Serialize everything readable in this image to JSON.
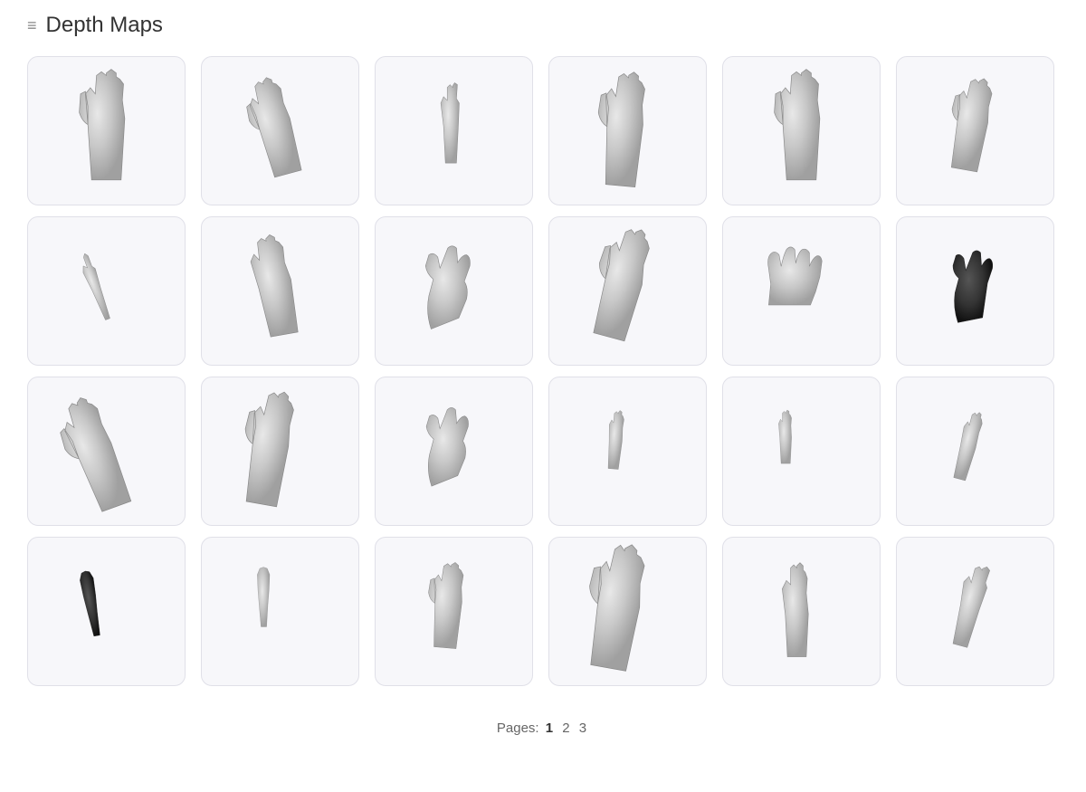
{
  "header": {
    "title": "Depth Maps",
    "icon": "≡"
  },
  "grid": {
    "rows": 4,
    "cols": 6,
    "total_cells": 24,
    "cells": [
      {
        "id": 1,
        "alt": "hand open front view upright",
        "pose": "open-upright",
        "rotation": 0,
        "scale": 1.0,
        "dark": false
      },
      {
        "id": 2,
        "alt": "hand open slightly angled",
        "pose": "open-angled",
        "rotation": -15,
        "scale": 0.9,
        "dark": false
      },
      {
        "id": 3,
        "alt": "hand side profile fingers up",
        "pose": "side-profile",
        "rotation": 0,
        "scale": 0.75,
        "dark": false
      },
      {
        "id": 4,
        "alt": "hand open palm facing",
        "pose": "open-palm",
        "rotation": 5,
        "scale": 1.0,
        "dark": false
      },
      {
        "id": 5,
        "alt": "hand open back view",
        "pose": "open-back",
        "rotation": 0,
        "scale": 1.0,
        "dark": false
      },
      {
        "id": 6,
        "alt": "hand open three-quarter view",
        "pose": "open-three-quarter",
        "rotation": 10,
        "scale": 0.85,
        "dark": false
      },
      {
        "id": 7,
        "alt": "hand side profile single finger",
        "pose": "side-single",
        "rotation": -20,
        "scale": 0.65,
        "dark": false
      },
      {
        "id": 8,
        "alt": "hand open slightly curled downward",
        "pose": "open-curl-down",
        "rotation": -10,
        "scale": 0.9,
        "dark": false
      },
      {
        "id": 9,
        "alt": "hand fingers spread curling",
        "pose": "spread-curl",
        "rotation": 0,
        "scale": 0.9,
        "dark": false
      },
      {
        "id": 10,
        "alt": "hand open reaching",
        "pose": "open-reaching",
        "rotation": 15,
        "scale": 1.0,
        "dark": false
      },
      {
        "id": 11,
        "alt": "hand flat spread horizontal",
        "pose": "flat-spread",
        "rotation": 0,
        "scale": 0.85,
        "dark": false
      },
      {
        "id": 12,
        "alt": "hand dark grasping",
        "pose": "dark-grasp",
        "rotation": 0,
        "scale": 0.8,
        "dark": true
      },
      {
        "id": 13,
        "alt": "hand palm up angled left",
        "pose": "palm-up-left",
        "rotation": -20,
        "scale": 1.0,
        "dark": false
      },
      {
        "id": 14,
        "alt": "hand palm up angled right",
        "pose": "palm-up-right",
        "rotation": 10,
        "scale": 1.0,
        "dark": false
      },
      {
        "id": 15,
        "alt": "hand fingers curling grab",
        "pose": "curl-grab",
        "rotation": 0,
        "scale": 0.85,
        "dark": false
      },
      {
        "id": 16,
        "alt": "hand vertical narrow",
        "pose": "vertical-narrow",
        "rotation": 5,
        "scale": 0.55,
        "dark": false
      },
      {
        "id": 17,
        "alt": "hand wrist up narrow",
        "pose": "wrist-narrow",
        "rotation": 0,
        "scale": 0.5,
        "dark": false
      },
      {
        "id": 18,
        "alt": "hand side angled right",
        "pose": "side-right",
        "rotation": 15,
        "scale": 0.65,
        "dark": false
      },
      {
        "id": 19,
        "alt": "hand arm downward dark",
        "pose": "arm-down-dark",
        "rotation": -10,
        "scale": 0.55,
        "dark": true
      },
      {
        "id": 20,
        "alt": "hand arm side view",
        "pose": "arm-side",
        "rotation": 0,
        "scale": 0.5,
        "dark": false
      },
      {
        "id": 21,
        "alt": "hand palm angled three-quarter",
        "pose": "palm-three-quarter",
        "rotation": 5,
        "scale": 0.75,
        "dark": false
      },
      {
        "id": 22,
        "alt": "hand open palm large",
        "pose": "open-large",
        "rotation": 10,
        "scale": 1.0,
        "dark": false
      },
      {
        "id": 23,
        "alt": "hand side profile palm",
        "pose": "side-palm",
        "rotation": 0,
        "scale": 0.85,
        "dark": false
      },
      {
        "id": 24,
        "alt": "hand slightly angled small",
        "pose": "angled-small",
        "rotation": 15,
        "scale": 0.75,
        "dark": false
      }
    ]
  },
  "pagination": {
    "label": "Pages:",
    "current": 1,
    "pages": [
      1,
      2,
      3
    ]
  }
}
